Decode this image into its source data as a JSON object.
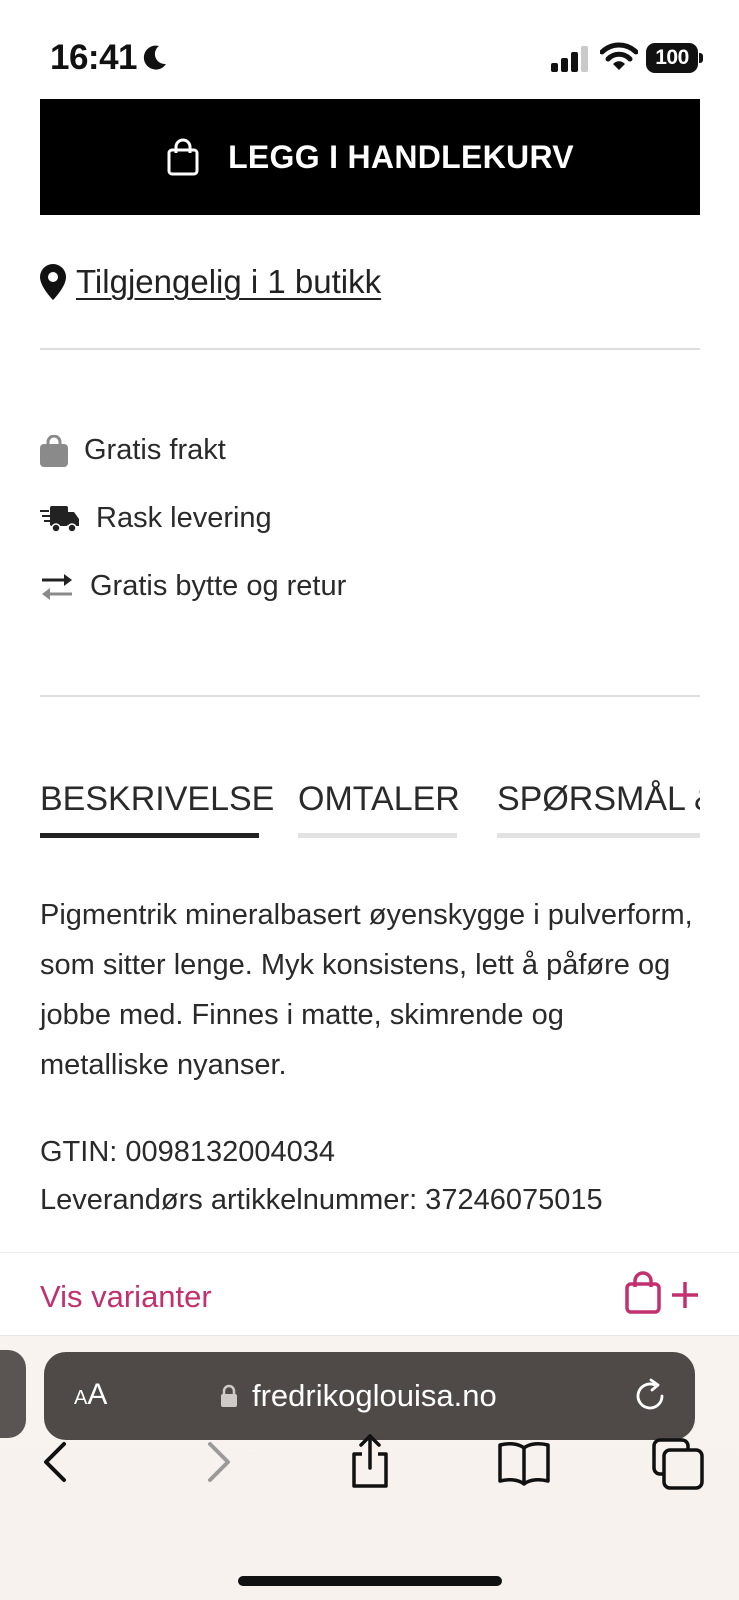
{
  "status_bar": {
    "time": "16:41",
    "battery": "100",
    "icons": [
      "moon-icon",
      "cellular-signal-icon",
      "wifi-icon",
      "battery-icon"
    ]
  },
  "product": {
    "add_to_cart_label": "LEGG I HANDLEKURV",
    "availability_link": "Tilgjengelig i 1 butikk"
  },
  "features": [
    {
      "label": "Gratis frakt",
      "icon": "shopping-bag-icon"
    },
    {
      "label": "Rask levering",
      "icon": "delivery-truck-icon"
    },
    {
      "label": "Gratis bytte og retur",
      "icon": "exchange-arrows-icon"
    }
  ],
  "tabs": [
    {
      "label": "BESKRIVELSE",
      "active": true
    },
    {
      "label": "OMTALER",
      "active": false
    },
    {
      "label": "SPØRSMÅL &",
      "active": false
    }
  ],
  "description": {
    "text": "Pigmentrik mineralbasert øyenskygge i pulverform, som sitter lenge. Myk konsistens, lett å påføre og jobbe med. Finnes i matte, skimrende og metalliske nyanser.",
    "gtin": "GTIN: 0098132004034",
    "supplier_article": "Leverandørs artikkelnummer: 37246075015"
  },
  "variant_bar": {
    "label": "Vis varianter",
    "accent_color": "#c2306f"
  },
  "browser": {
    "aa_small": "A",
    "aa_large": "A",
    "url": "fredrikoglouisa.no",
    "toolbar": [
      "back-icon",
      "forward-icon",
      "share-icon",
      "bookmarks-icon",
      "tabs-icon"
    ]
  }
}
